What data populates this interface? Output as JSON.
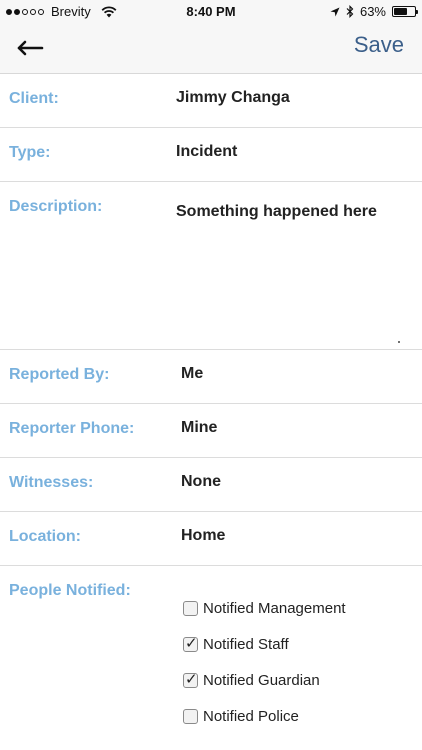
{
  "status_bar": {
    "carrier": "Brevity",
    "time": "8:40 PM",
    "battery": "63%",
    "battery_level": 0.63,
    "signal_bars": 2
  },
  "nav": {
    "save_label": "Save",
    "back_icon": "arrow-left-icon"
  },
  "form": {
    "client": {
      "label": "Client:",
      "value": "Jimmy Changa"
    },
    "type": {
      "label": "Type:",
      "value": "Incident"
    },
    "description": {
      "label": "Description:",
      "value": "Something happened here"
    },
    "reported_by": {
      "label": "Reported By:",
      "value": "Me"
    },
    "reporter_phone": {
      "label": "Reporter Phone:",
      "value": "Mine"
    },
    "witnesses": {
      "label": "Witnesses:",
      "value": "None"
    },
    "location": {
      "label": "Location:",
      "value": "Home"
    },
    "people_notified": {
      "label": "People Notified:",
      "options": [
        {
          "label": "Notified Management",
          "checked": false
        },
        {
          "label": "Notified Staff",
          "checked": true
        },
        {
          "label": "Notified Guardian",
          "checked": true
        },
        {
          "label": "Notified Police",
          "checked": false
        }
      ]
    }
  },
  "colors": {
    "label": "#79b1dd",
    "accent": "#3b5f8a"
  }
}
